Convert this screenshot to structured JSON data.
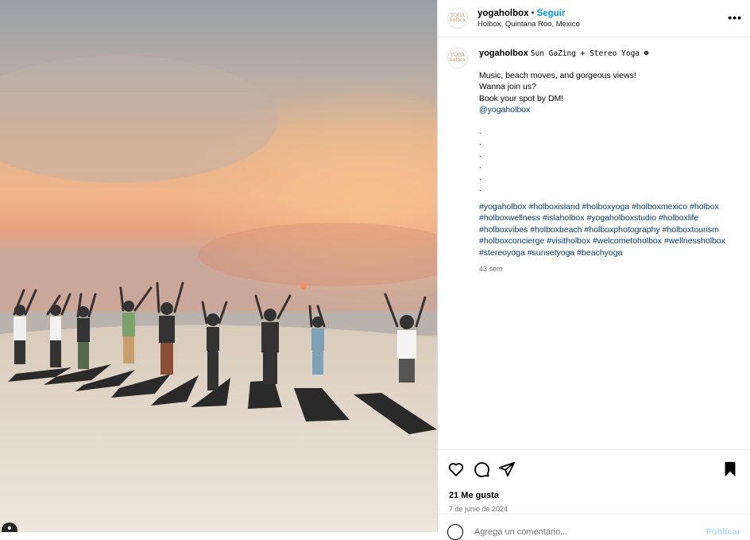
{
  "post": {
    "username": "yogaholbox",
    "separator": "•",
    "follow_label": "Seguir",
    "location": "Holbox, Quintana Roo, Mexico",
    "avatar_text": "YOGA holbox"
  },
  "caption": {
    "username": "yogaholbox",
    "title": "Sun GaZing + Stereo Yoga ☻",
    "lines": [
      "Music, beach moves, and gorgeous views!",
      "Wanna join us?",
      "Book your spot by DM!"
    ],
    "mention": "@yogaholbox",
    "dots": [
      ".",
      ".",
      ".",
      ".",
      ".",
      "."
    ],
    "hashtags": [
      "#yogaholbox",
      "#holboxisland",
      "#holboxyoga",
      "#holboxmexico",
      "#holbox",
      "#holboxwellness",
      "#islaholbox",
      "#yogaholboxstudio",
      "#holboxlife",
      "#holboxvibes",
      "#holboxbeach",
      "#holboxphotography",
      "#holboxtourism",
      "#holboxconcierge",
      "#visitholbox",
      "#welcometoholbox",
      "#wellnessholbox",
      "#stereoyoga",
      "#sunsetyoga",
      "#beachyoga"
    ],
    "ago": "43 sem"
  },
  "actions": {
    "icons": [
      "heart-icon",
      "comment-icon",
      "share-icon",
      "bookmark-icon"
    ],
    "likes": "21 Me gusta",
    "date": "7 de junio de 2024"
  },
  "comment": {
    "placeholder": "Agrega un comentario...",
    "post_label": "Publicar"
  },
  "colors": {
    "link": "#0095f6",
    "hashtag": "#00376b",
    "muted": "#737373",
    "post_disabled": "#b2dffc"
  }
}
